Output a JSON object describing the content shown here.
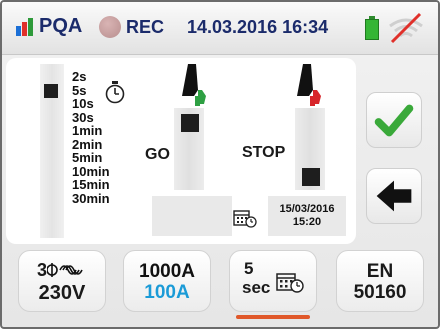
{
  "status_bar": {
    "app_label": "PQA",
    "rec_label": "REC",
    "datetime": "14.03.2016 16:34",
    "logo_colors": [
      "#1b6fd6",
      "#e0302a",
      "#2e9a3a"
    ],
    "battery_color": "#35b535",
    "icons": {
      "logo": "bar-chart-logo",
      "rec": "record-dot",
      "battery": "battery-icon",
      "wifi": "wifi-disabled-icon"
    }
  },
  "interval": {
    "options": [
      "2s",
      "5s",
      "10s",
      "30s",
      "1min",
      "2min",
      "5min",
      "10min",
      "15min",
      "30min"
    ],
    "selected": "5s",
    "icon": "stopwatch-icon"
  },
  "start": {
    "label": "GO",
    "date": "",
    "time": "",
    "icon": "pointing-hand-green-icon",
    "accent": "#2ea043"
  },
  "stop": {
    "label": "STOP",
    "date": "15/03/2016",
    "time": "15:20",
    "icon": "pointing-hand-red-icon",
    "accent": "#d7262b"
  },
  "buttons": {
    "confirm_icon": "checkmark-icon",
    "confirm_color": "#3aa93a",
    "back_icon": "back-arrow-icon"
  },
  "tabs": [
    {
      "line1": "3",
      "line2": "230V",
      "icon": "three-phase-icon"
    },
    {
      "line1": "1000A",
      "line2": "100A",
      "line2_color": "#1b9bd7"
    },
    {
      "line1": "5",
      "line2": "sec",
      "icon": "calendar-clock-icon",
      "active": true,
      "active_color": "#e0582a"
    },
    {
      "line1": "EN",
      "line2": "50160"
    }
  ]
}
